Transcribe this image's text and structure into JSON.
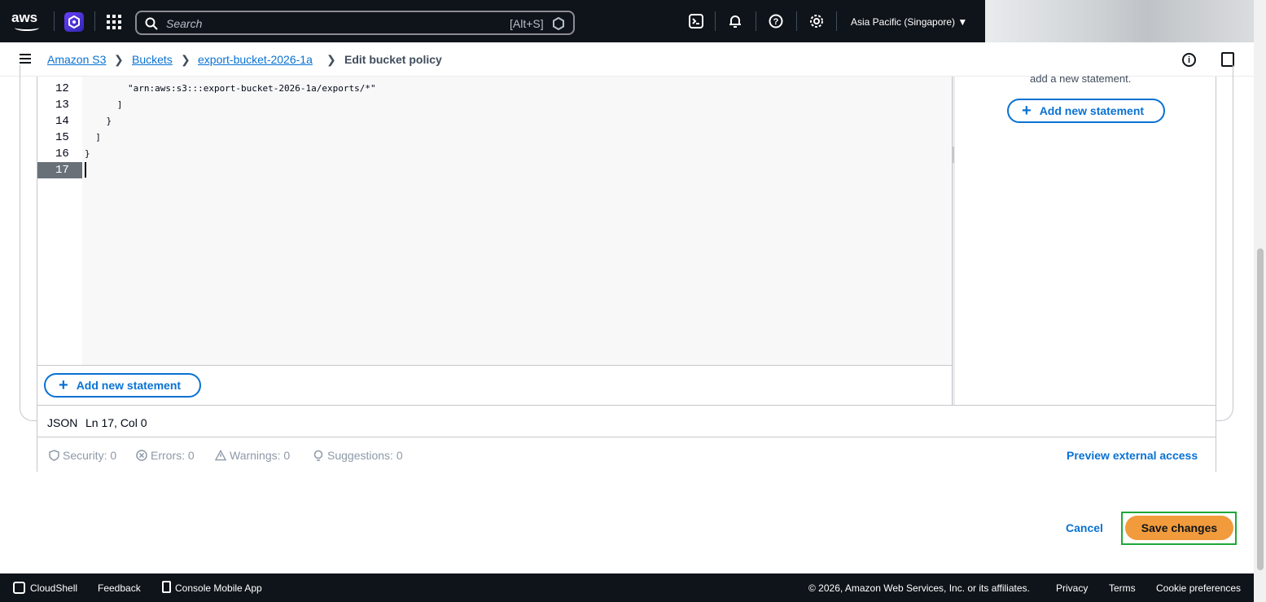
{
  "topnav": {
    "logo_text": "aws",
    "search_placeholder": "Search",
    "search_shortcut": "[Alt+S]",
    "region": "Asia Pacific (Singapore) ▼"
  },
  "breadcrumb": {
    "items": [
      "Amazon S3",
      "Buckets",
      "export-bucket-2026-1a"
    ],
    "current": "Edit bucket policy"
  },
  "editor": {
    "lines": [
      {
        "num": "12",
        "code": "        \"arn:aws:s3:::export-bucket-2026-1a/exports/*\""
      },
      {
        "num": "13",
        "code": "      ]"
      },
      {
        "num": "14",
        "code": "    }"
      },
      {
        "num": "15",
        "code": "  ]"
      },
      {
        "num": "16",
        "code": "}"
      },
      {
        "num": "17",
        "code": ""
      }
    ],
    "active_line": "17",
    "side_text": "add a new statement.",
    "add_statement_label": "Add new statement",
    "mode": "JSON",
    "cursor_position": "Ln 17, Col 0"
  },
  "validation": {
    "security": "Security: 0",
    "errors": "Errors: 0",
    "warnings": "Warnings: 0",
    "suggestions": "Suggestions: 0",
    "preview_link": "Preview external access"
  },
  "actions": {
    "cancel": "Cancel",
    "save": "Save changes"
  },
  "footer": {
    "cloudshell": "CloudShell",
    "feedback": "Feedback",
    "mobile_app": "Console Mobile App",
    "copyright": "© 2026, Amazon Web Services, Inc. or its affiliates.",
    "privacy": "Privacy",
    "terms": "Terms",
    "cookies": "Cookie preferences"
  },
  "colors": {
    "accent": "#0972d3",
    "nav_bg": "#0f141a",
    "primary_button": "#f19b3c",
    "highlight_border": "#1fa83a"
  }
}
